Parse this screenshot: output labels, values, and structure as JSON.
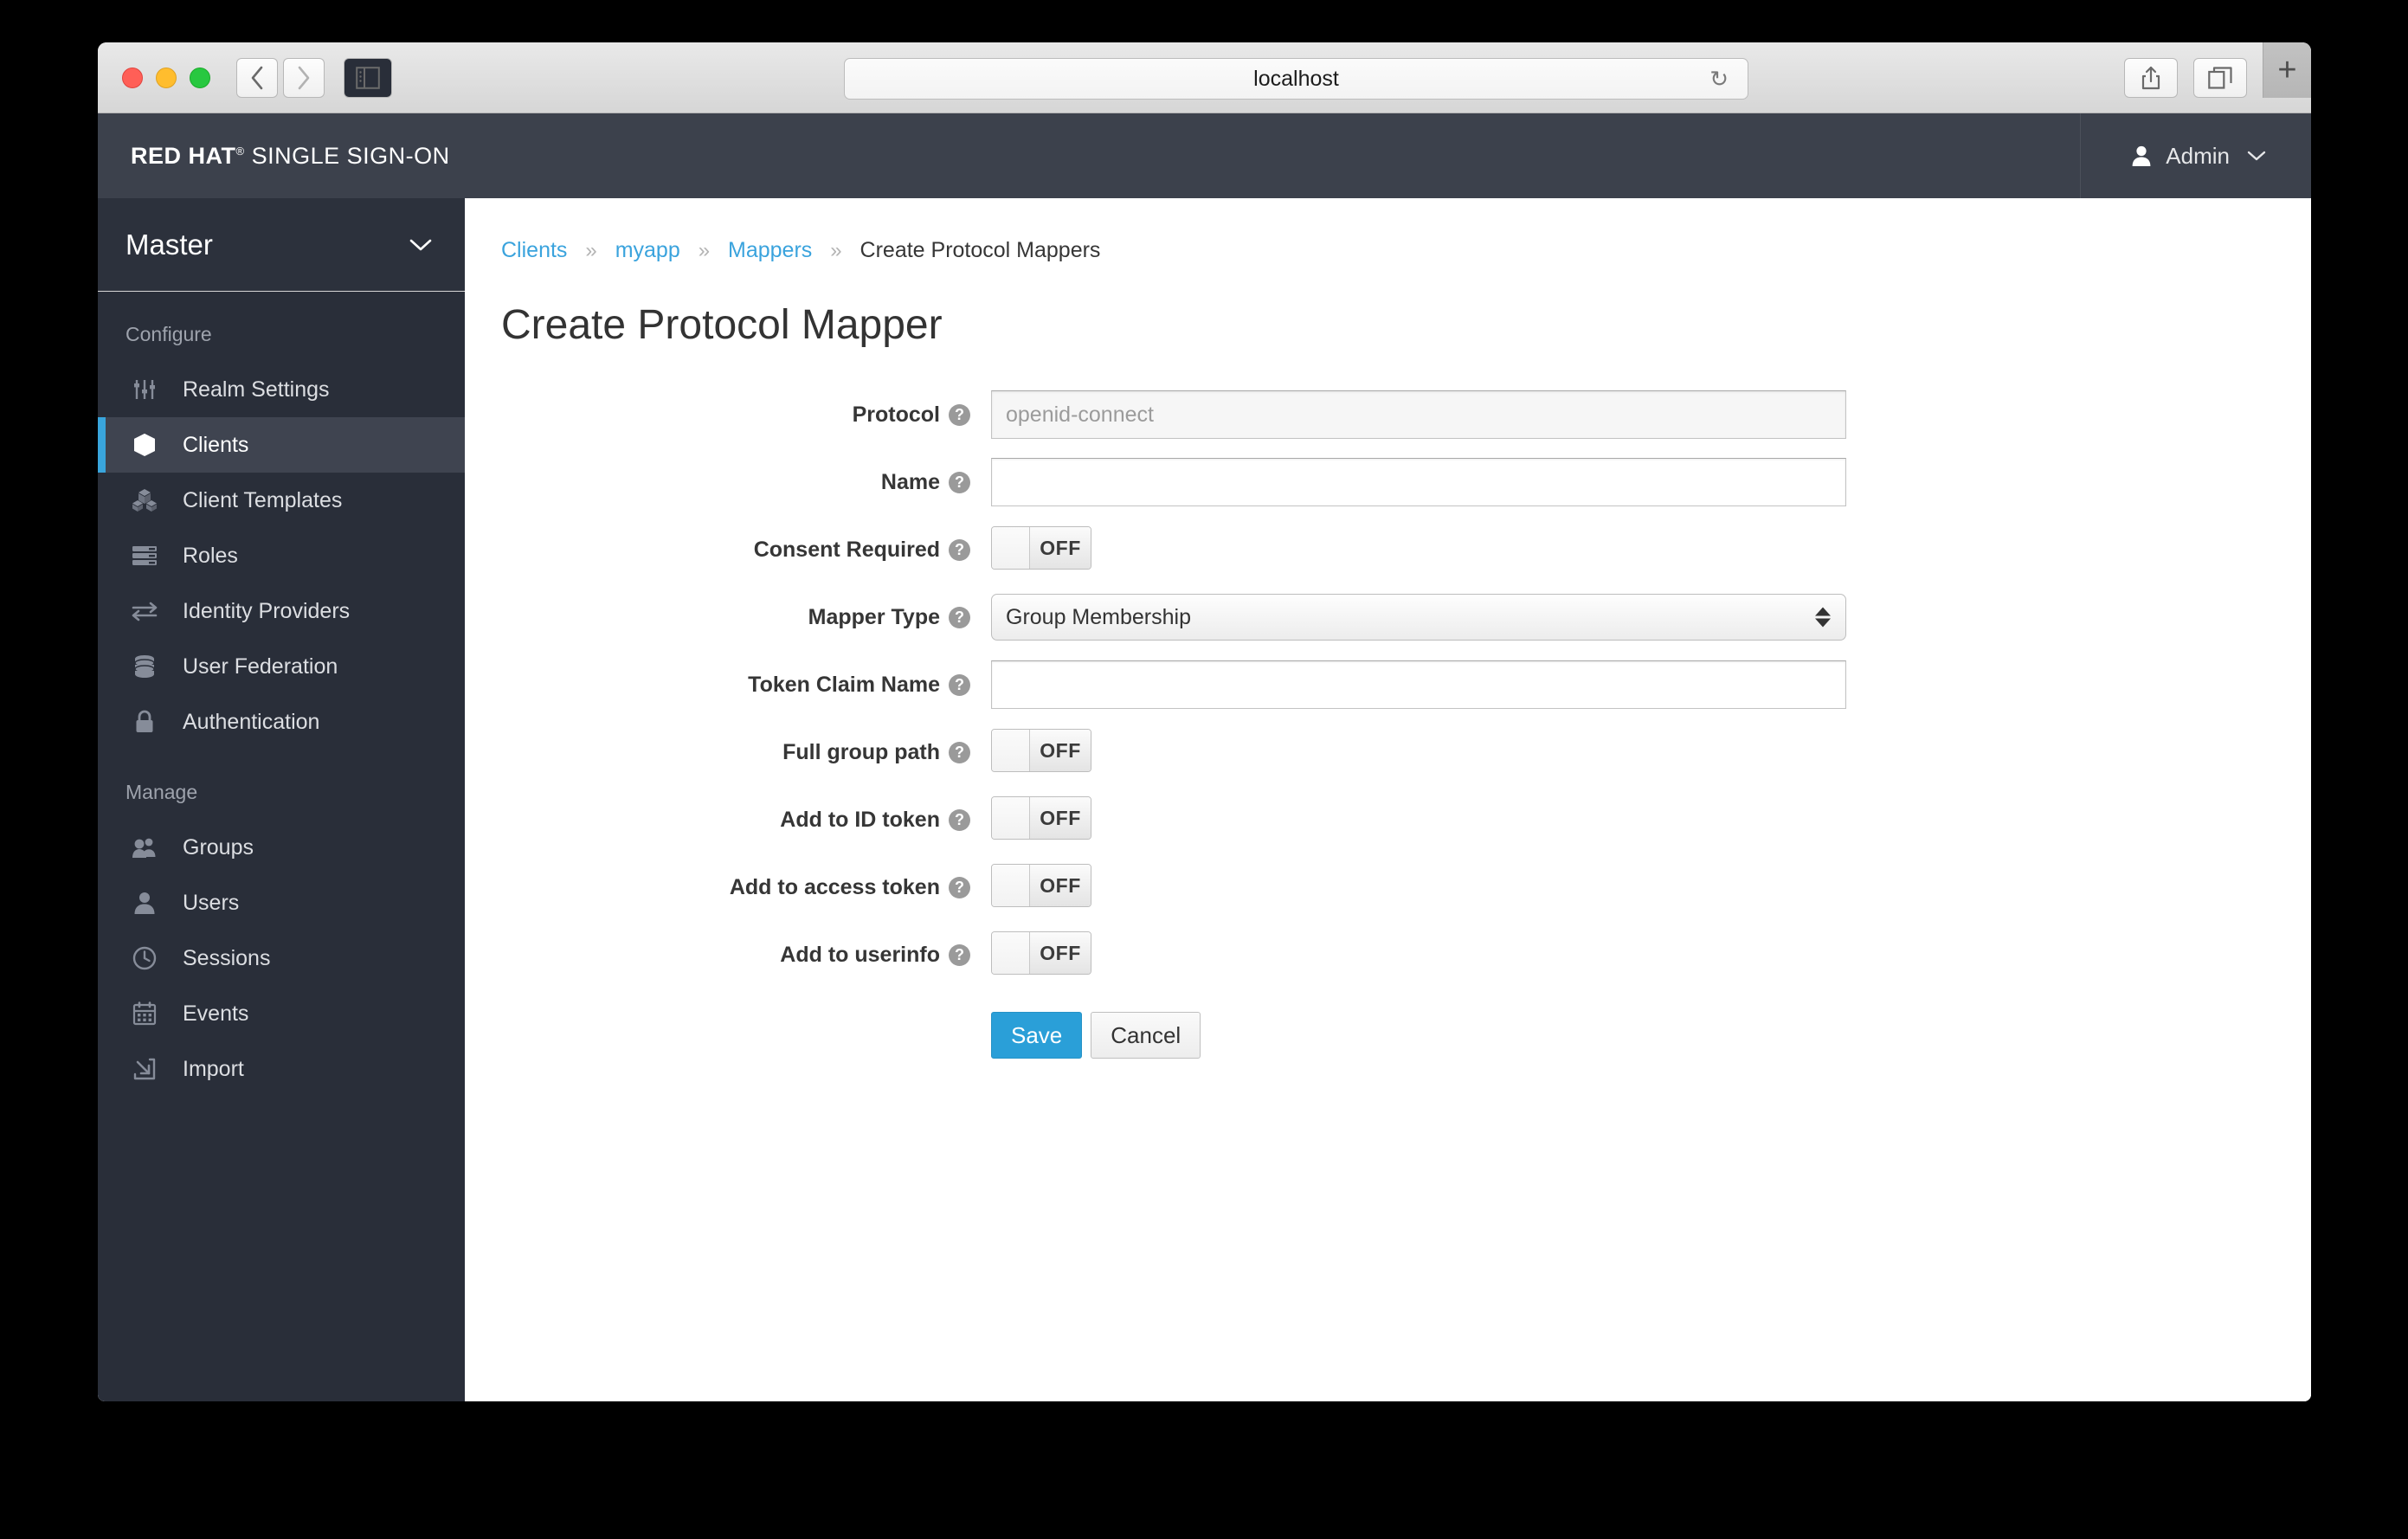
{
  "browser": {
    "url": "localhost",
    "back_icon": "chevron-left-icon",
    "forward_icon": "chevron-right-icon",
    "sidebar_icon": "sidebar-toggle-icon",
    "reload_icon": "reload-icon",
    "share_icon": "share-icon",
    "tabs_icon": "show-tabs-icon",
    "newtab_label": "+"
  },
  "masthead": {
    "brand_bold": "RED HAT",
    "brand_reg": "®",
    "brand_light": "SINGLE SIGN-ON",
    "user_label": "Admin",
    "user_icon": "user-avatar-icon",
    "caret_icon": "chevron-down-icon"
  },
  "sidebar": {
    "realm": "Master",
    "realm_caret_icon": "chevron-down-icon",
    "sections": [
      {
        "title": "Configure",
        "items": [
          {
            "label": "Realm Settings",
            "icon": "sliders-icon",
            "active": false
          },
          {
            "label": "Clients",
            "icon": "cube-icon",
            "active": true
          },
          {
            "label": "Client Templates",
            "icon": "cubes-icon",
            "active": false
          },
          {
            "label": "Roles",
            "icon": "server-rows-icon",
            "active": false
          },
          {
            "label": "Identity Providers",
            "icon": "exchange-arrows-icon",
            "active": false
          },
          {
            "label": "User Federation",
            "icon": "database-icon",
            "active": false
          },
          {
            "label": "Authentication",
            "icon": "lock-icon",
            "active": false
          }
        ]
      },
      {
        "title": "Manage",
        "items": [
          {
            "label": "Groups",
            "icon": "users-group-icon",
            "active": false
          },
          {
            "label": "Users",
            "icon": "user-icon",
            "active": false
          },
          {
            "label": "Sessions",
            "icon": "clock-icon",
            "active": false
          },
          {
            "label": "Events",
            "icon": "calendar-icon",
            "active": false
          },
          {
            "label": "Import",
            "icon": "import-arrow-icon",
            "active": false
          }
        ]
      }
    ]
  },
  "breadcrumb": [
    {
      "label": "Clients",
      "link": true
    },
    {
      "label": "myapp",
      "link": true
    },
    {
      "label": "Mappers",
      "link": true
    },
    {
      "label": "Create Protocol Mappers",
      "link": false
    }
  ],
  "breadcrumb_separator": "»",
  "page": {
    "title": "Create Protocol Mapper"
  },
  "form": {
    "protocol": {
      "label": "Protocol",
      "value": "openid-connect",
      "disabled": true
    },
    "name": {
      "label": "Name",
      "value": "",
      "placeholder": ""
    },
    "consent_required": {
      "label": "Consent Required",
      "state": "OFF"
    },
    "mapper_type": {
      "label": "Mapper Type",
      "value": "Group Membership"
    },
    "token_claim_name": {
      "label": "Token Claim Name",
      "value": "",
      "placeholder": ""
    },
    "full_group_path": {
      "label": "Full group path",
      "state": "OFF"
    },
    "add_to_id_token": {
      "label": "Add to ID token",
      "state": "OFF"
    },
    "add_to_access_token": {
      "label": "Add to access token",
      "state": "OFF"
    },
    "add_to_userinfo": {
      "label": "Add to userinfo",
      "state": "OFF"
    },
    "help_glyph": "?"
  },
  "actions": {
    "save": "Save",
    "cancel": "Cancel"
  },
  "colors": {
    "accent_blue": "#2a9fd8",
    "link_blue": "#3aa3dd",
    "masthead_bg": "#3c414c",
    "sidebar_bg": "#292e39",
    "sidebar_active_bg": "#3f4450",
    "sidebar_active_bar": "#39a5dc"
  }
}
